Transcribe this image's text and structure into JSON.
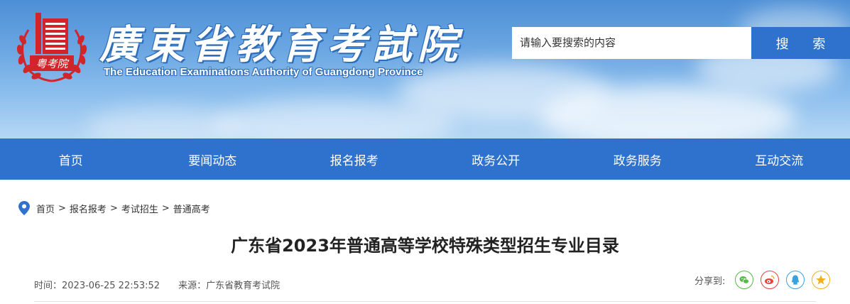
{
  "header": {
    "logo_text": "粤考院",
    "site_title": "廣東省教育考試院",
    "site_subtitle": "The Education Examinations Authority of Guangdong Province",
    "search": {
      "placeholder": "请输入要搜索的内容",
      "value": "",
      "button_label": "搜 索"
    }
  },
  "nav": {
    "items": [
      {
        "label": "首页"
      },
      {
        "label": "要闻动态"
      },
      {
        "label": "报名报考"
      },
      {
        "label": "政务公开"
      },
      {
        "label": "政务服务"
      },
      {
        "label": "互动交流"
      }
    ]
  },
  "breadcrumb": {
    "icon": "location-pin-icon",
    "items": [
      {
        "label": "首页"
      },
      {
        "label": "报名报考"
      },
      {
        "label": "考试招生"
      },
      {
        "label": "普通高考"
      }
    ],
    "separator": ">"
  },
  "article": {
    "title": "广东省2023年普通高等学校特殊类型招生专业目录",
    "time": "时间：2023-06-25 22:53:52",
    "source": "来源：广东省教育考试院"
  },
  "share": {
    "label": "分享到:",
    "icons": [
      "wechat-icon",
      "weibo-icon",
      "qq-icon",
      "qzone-icon"
    ]
  },
  "colors": {
    "primary": "#2f72cd",
    "logo_red": "#d0252a",
    "wechat": "#59b84a",
    "weibo": "#e8423b",
    "qq": "#3aa3de",
    "qzone": "#f2b01e"
  }
}
